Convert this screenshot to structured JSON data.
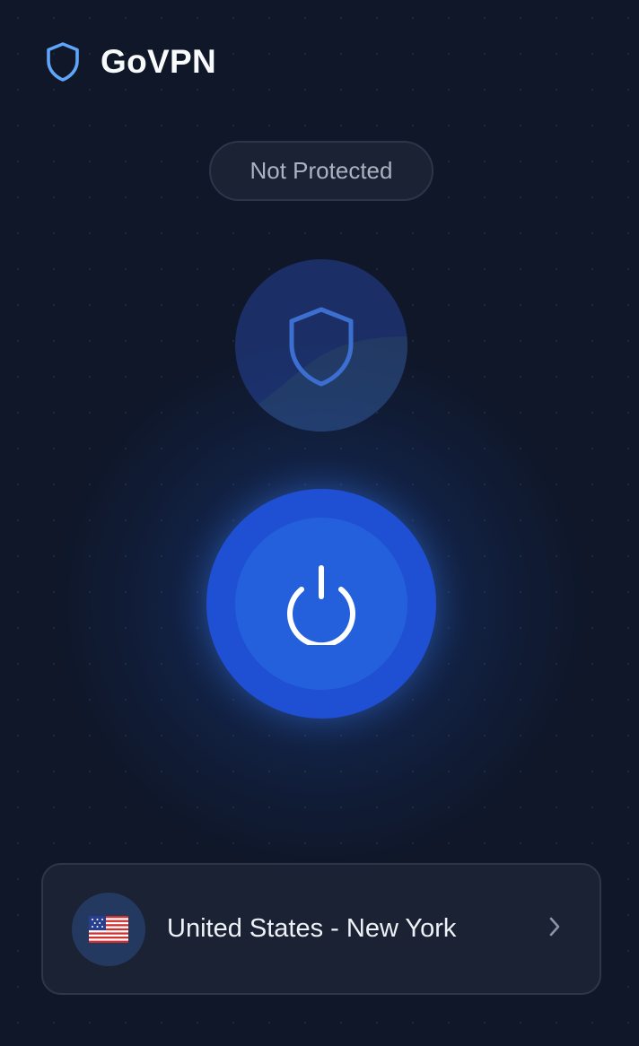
{
  "app": {
    "title": "GoVPN"
  },
  "status": {
    "label": "Not Protected"
  },
  "location": {
    "country": "United States",
    "city": "New York",
    "label": "United States - New York",
    "flag": "us-flag"
  },
  "icons": {
    "logo": "shield-icon",
    "status_shield": "shield-icon",
    "power": "power-icon",
    "chevron": "chevron-right-icon"
  },
  "colors": {
    "background": "#0f1729",
    "accent": "#2563eb",
    "logo_blue": "#60a5fa",
    "status_text": "#aab3c0"
  }
}
